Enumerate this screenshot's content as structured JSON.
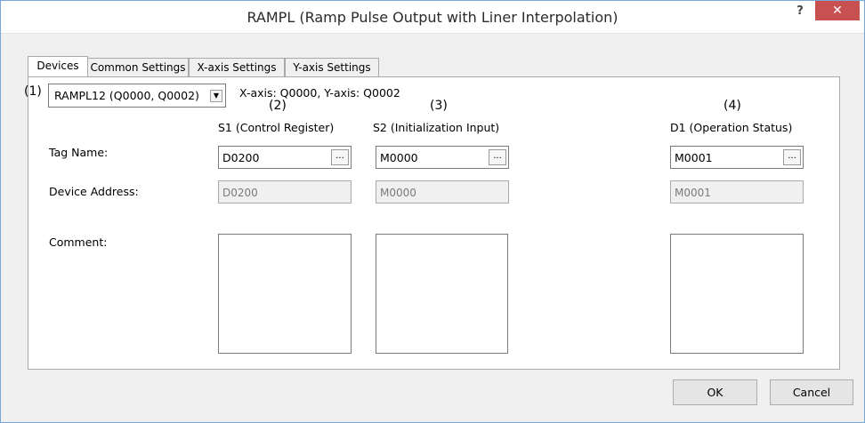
{
  "window": {
    "title": "RAMPL (Ramp Pulse Output with Liner Interpolation)",
    "help_label": "?",
    "close_label": "✕",
    "close_color": "#c75050"
  },
  "tabs": [
    {
      "label": "Devices",
      "active": true
    },
    {
      "label": "Common Settings",
      "active": false
    },
    {
      "label": "X-axis Settings",
      "active": false
    },
    {
      "label": "Y-axis Settings",
      "active": false
    }
  ],
  "markers": {
    "m1": "(1)",
    "m2": "(2)",
    "m3": "(3)",
    "m4": "(4)"
  },
  "instruction_selector": {
    "value": "RAMPL12 (Q0000, Q0002)",
    "dropdown_icon": "chevron-down-icon"
  },
  "axis_info": "X-axis: Q0000, Y-axis: Q0002",
  "row_labels": {
    "tag_name": "Tag Name:",
    "device_address": "Device Address:",
    "comment": "Comment:"
  },
  "columns": [
    {
      "header": "S1 (Control Register)",
      "tag_name": "D0200",
      "device_address": "D0200",
      "comment": ""
    },
    {
      "header": "S2 (Initialization Input)",
      "tag_name": "M0000",
      "device_address": "M0000",
      "comment": ""
    },
    {
      "header": "D1 (Operation Status)",
      "tag_name": "M0001",
      "device_address": "M0001",
      "comment": ""
    }
  ],
  "browse_label": "...",
  "buttons": {
    "ok": "OK",
    "cancel": "Cancel"
  }
}
